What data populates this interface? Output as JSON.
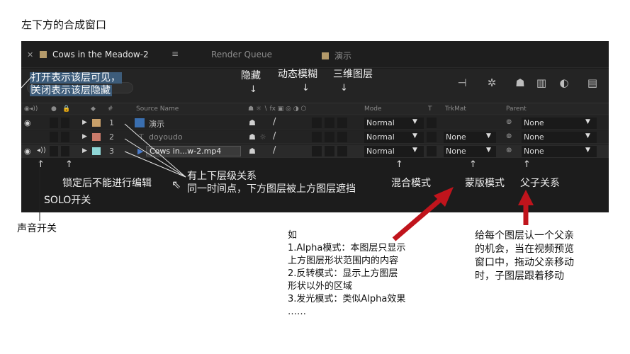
{
  "heading": "左下方的合成窗口",
  "tabs": [
    {
      "label": "Cows in the Meadow-2",
      "active": true,
      "menu": "≡"
    },
    {
      "label": "Render Queue",
      "active": false
    },
    {
      "label": "演示",
      "active": false
    }
  ],
  "toolbar_icons": [
    "composition-mini-flowchart-icon",
    "draft-3d-icon",
    "shy-switch-icon",
    "frame-blending-icon",
    "motion-blur-icon",
    "graph-editor-icon"
  ],
  "columns": {
    "source_name": "Source Name",
    "mode": "Mode",
    "t": "T",
    "trkmat": "TrkMat",
    "parent": "Parent",
    "hash": "#"
  },
  "layers": [
    {
      "num": "1",
      "name": "演示",
      "mode": "Normal",
      "trkmat": "",
      "parent": "None",
      "label_color": "#c8a06a"
    },
    {
      "num": "2",
      "name": "doyoudo",
      "mode": "Normal",
      "trkmat": "None",
      "parent": "None",
      "label_color": "#c97a6a"
    },
    {
      "num": "3",
      "name": "Cows in...w-2.mp4",
      "mode": "Normal",
      "trkmat": "None",
      "parent": "None",
      "label_color": "#8fd6d6"
    }
  ],
  "annotations": {
    "visibility_line1": "打开表示该层可见，",
    "visibility_line2": "关闭表示该层隐藏",
    "shy": "隐藏",
    "motion_blur": "动态模糊",
    "three_d": "三维图层",
    "lock": "锁定后不能进行编辑",
    "solo": "SOLO开关",
    "audio": "声音开关",
    "hierarchy_line1": "有上下层级关系",
    "hierarchy_line2": "同一时间点，下方图层被上方图层遮挡",
    "blend": "混合模式",
    "mask": "蒙版模式",
    "parent": "父子关系"
  },
  "mask_note": [
    "如",
    "1.Alpha模式：本图层只显示",
    "上方图层形状范围内的内容",
    "2.反转模式：显示上方图层",
    "形状以外的区域",
    "3.发光模式：类似Alpha效果",
    "……"
  ],
  "parent_note": [
    "给每个图层认一个父亲",
    "的机会，当在视频预览",
    "窗口中，拖动父亲移动",
    "时，子图层跟着移动"
  ],
  "colors": {
    "panel_bg": "#1c1c1c",
    "arrow_red": "#c0141c"
  }
}
